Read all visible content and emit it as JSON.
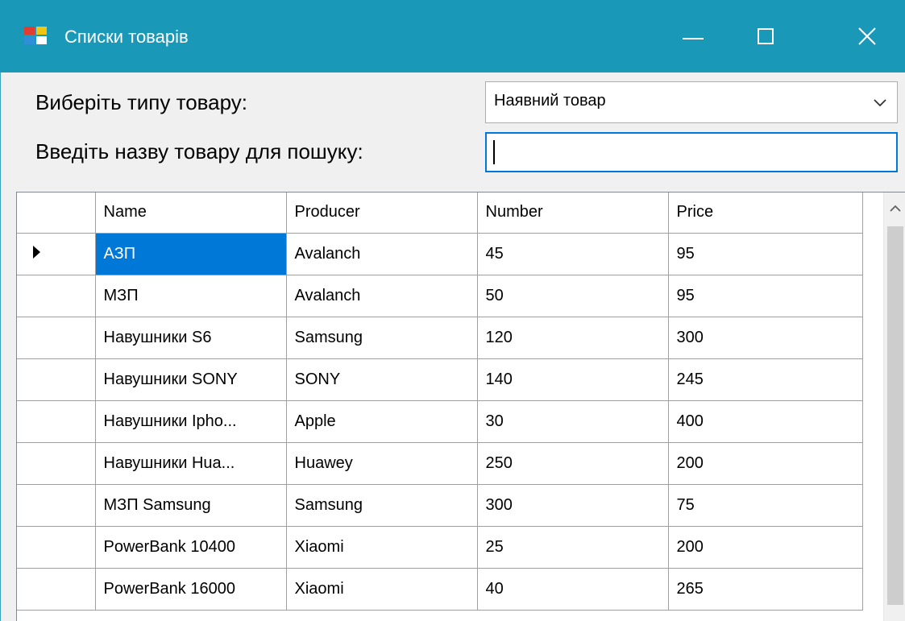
{
  "window": {
    "title": "Списки товарів",
    "accent_color": "#1a98b7"
  },
  "form": {
    "type_label": "Виберіть типу товару:",
    "type_selected": "Наявний товар",
    "search_label": "Введіть назву товару для пошуку:",
    "search_value": ""
  },
  "grid": {
    "columns": [
      "Name",
      "Producer",
      "Number",
      "Price"
    ],
    "rows": [
      [
        "АЗП",
        "Avalanch",
        "45",
        "95"
      ],
      [
        "МЗП",
        "Avalanch",
        "50",
        "95"
      ],
      [
        "Навушники S6",
        "Samsung",
        "120",
        "300"
      ],
      [
        "Навушники SONY",
        "SONY",
        "140",
        "245"
      ],
      [
        "Навушники Ipho...",
        "Apple",
        "30",
        "400"
      ],
      [
        "Навушники Hua...",
        "Huawey",
        "250",
        "200"
      ],
      [
        "МЗП Samsung",
        "Samsung",
        "300",
        "75"
      ],
      [
        "PowerBank 10400",
        "Xiaomi",
        "25",
        "200"
      ],
      [
        "PowerBank 16000",
        "Xiaomi",
        "40",
        "265"
      ]
    ],
    "selected_row": 0,
    "selection_color": "#0078d7"
  }
}
